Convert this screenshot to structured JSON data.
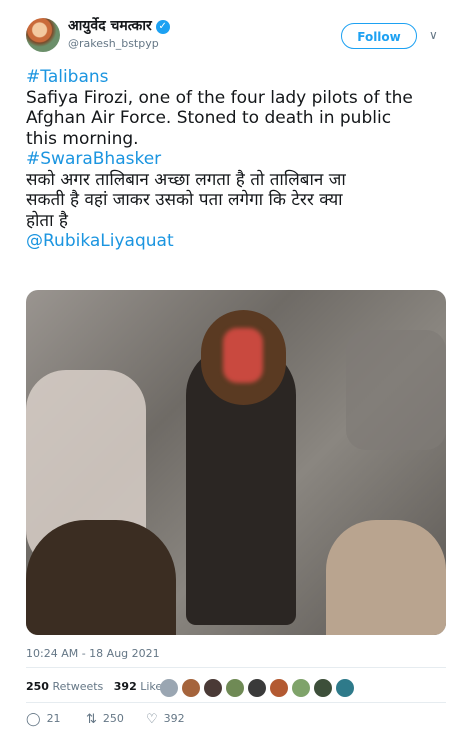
{
  "user": {
    "name": "आयुर्वेद चमत्कार",
    "handle": "@rakesh_bstpyp",
    "follow_label": "Follow"
  },
  "tweet": {
    "lines": [
      "#Talibans",
      "Safiya Firozi, one of the four lady pilots of the",
      "Afghan Air Force. Stoned to death in public",
      "this morning.",
      "#SwaraBhasker",
      "सको अगर तालिबान अच्छा लगता है तो तालिबान जा",
      "सकती है वहां जाकर उसको पता लगेगा कि टेरर क्या",
      "होता है",
      "@RubikaLiyaquat"
    ]
  },
  "timestamp": "10:24 AM - 18 Aug 2021",
  "stats": {
    "retweets_count": "250",
    "retweets_label": "Retweets",
    "likes_count": "392",
    "likes_label": "Likes"
  },
  "actions": {
    "replies": "21",
    "retweets": "250",
    "likes": "392"
  },
  "colors": {
    "link": "#1b95e0",
    "follow": "#1da1f2",
    "muted": "#657786"
  }
}
